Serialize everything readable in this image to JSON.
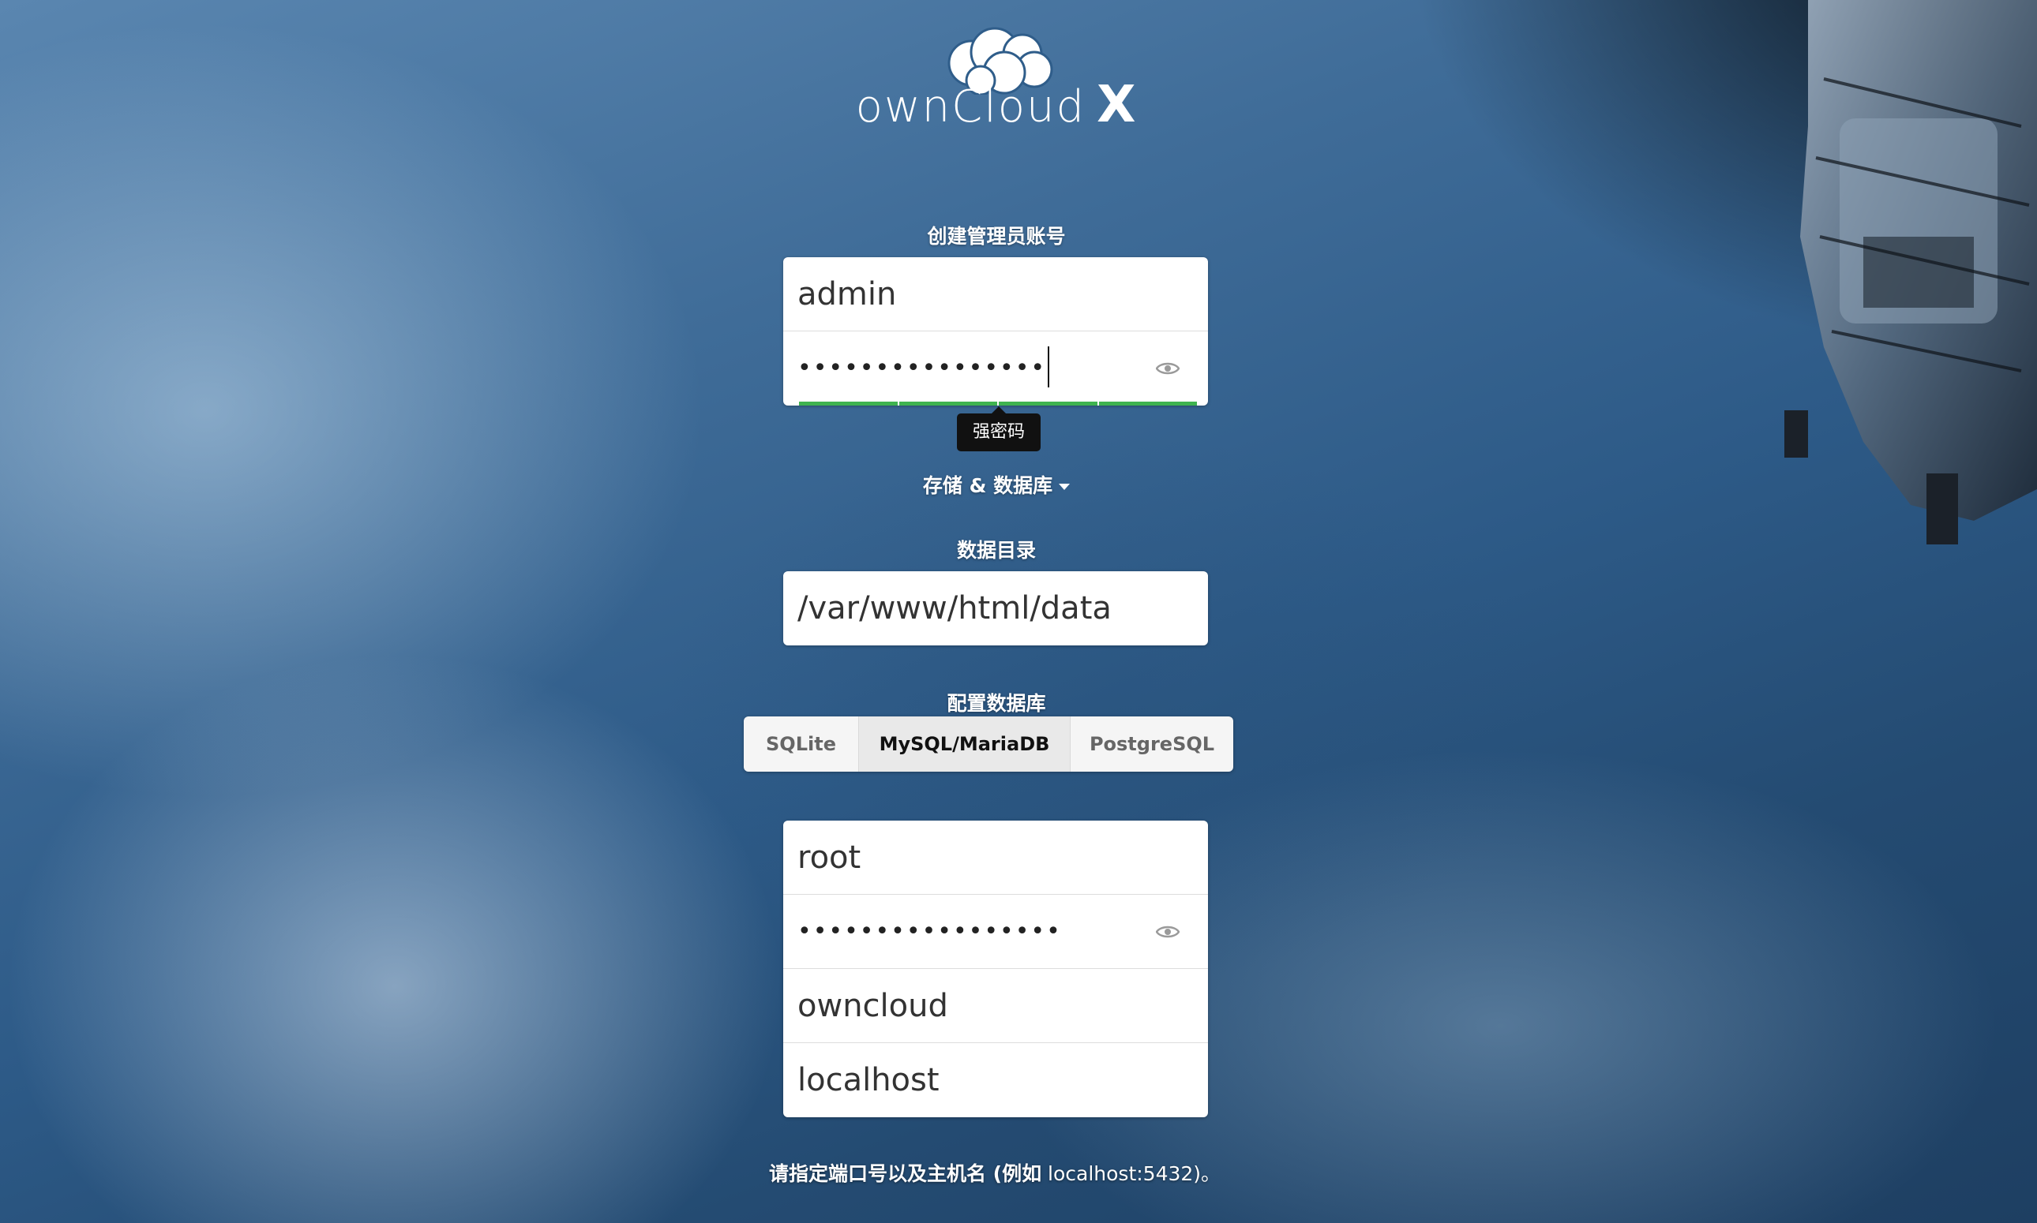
{
  "logo": {
    "name": "ownCloud",
    "suffix": "X"
  },
  "admin_section": {
    "label": "创建管理员账号",
    "username_value": "admin",
    "password_mask": "••••••••••••••••",
    "password_strength_tooltip": "强密码"
  },
  "storage_toggle": {
    "label": "存储 & 数据库"
  },
  "data_dir_section": {
    "label": "数据目录",
    "value": "/var/www/html/data"
  },
  "db_section": {
    "label": "配置数据库",
    "tabs": [
      {
        "label": "SQLite",
        "active": false
      },
      {
        "label": "MySQL/MariaDB",
        "active": true
      },
      {
        "label": "PostgreSQL",
        "active": false
      }
    ],
    "db_user_value": "root",
    "db_password_mask": "•••••••••••••••••",
    "db_name_value": "owncloud",
    "db_host_value": "localhost"
  },
  "hint": {
    "text_strong": "请指定端口号以及主机名 (例如",
    "text_rest": " localhost:5432)。"
  },
  "colors": {
    "strength_bar": "#3fb34f",
    "tooltip_bg": "#111111"
  },
  "icons": {
    "show_password": "eye-icon",
    "dropdown": "caret-down-icon"
  }
}
